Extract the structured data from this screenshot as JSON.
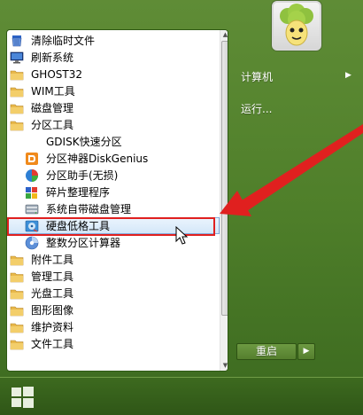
{
  "programs": {
    "items": [
      {
        "label": "清除临时文件",
        "icon": "broom-icon"
      },
      {
        "label": "刷新系统",
        "icon": "monitor-icon"
      },
      {
        "label": "GHOST32",
        "icon": "folder-icon"
      },
      {
        "label": "WIM工具",
        "icon": "folder-icon"
      },
      {
        "label": "磁盘管理",
        "icon": "folder-icon"
      },
      {
        "label": "分区工具",
        "icon": "folder-icon"
      },
      {
        "label": "GDISK快速分区",
        "icon": "blank-icon"
      },
      {
        "label": "分区神器DiskGenius",
        "icon": "diskgenius-icon"
      },
      {
        "label": "分区助手(无损)",
        "icon": "partition-assistant-icon"
      },
      {
        "label": "碎片整理程序",
        "icon": "defrag-icon"
      },
      {
        "label": "系统自带磁盘管理",
        "icon": "disk-manager-icon"
      },
      {
        "label": "硬盘低格工具",
        "icon": "lowformat-icon"
      },
      {
        "label": "整数分区计算器",
        "icon": "calculator-icon"
      },
      {
        "label": "附件工具",
        "icon": "folder-icon"
      },
      {
        "label": "管理工具",
        "icon": "folder-icon"
      },
      {
        "label": "光盘工具",
        "icon": "folder-icon"
      },
      {
        "label": "图形图像",
        "icon": "folder-icon"
      },
      {
        "label": "维护资料",
        "icon": "folder-icon"
      },
      {
        "label": "文件工具",
        "icon": "folder-icon"
      }
    ],
    "highlighted_index": 11
  },
  "right_panel": {
    "computer_label": "计算机",
    "run_label": "运行..."
  },
  "power": {
    "restart_label": "重启"
  },
  "colors": {
    "menu_green": "#4f7f2a",
    "highlight_border": "#84acdd",
    "annotation_red": "#e0201f"
  }
}
